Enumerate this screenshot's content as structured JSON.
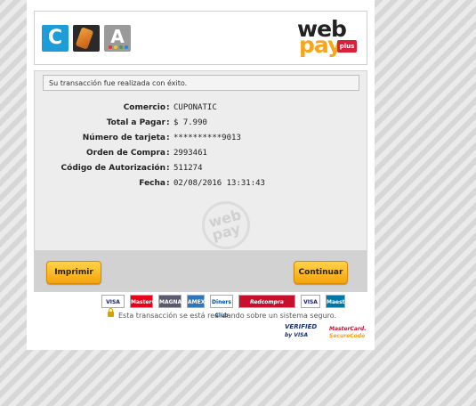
{
  "header": {
    "logos": [
      {
        "name": "cuponatic-logo",
        "text": "C",
        "color": "#1e9cd8"
      },
      {
        "name": "tag-logo",
        "text": "",
        "color": "#2a2a2a"
      },
      {
        "name": "a-logo",
        "text": "A",
        "color": "#9a9a9a"
      }
    ],
    "webpay": {
      "web": "web",
      "pay": "pay",
      "plus": "plus"
    }
  },
  "status_message": "Su transacción fue realizada con éxito.",
  "details": [
    {
      "label": "Comercio",
      "value": "CUPONATIC"
    },
    {
      "label": "Total a Pagar",
      "value": "$ 7.990"
    },
    {
      "label": "Número de tarjeta",
      "value": "**********9013"
    },
    {
      "label": "Orden de Compra",
      "value": "2993461"
    },
    {
      "label": "Código de Autorización",
      "value": "511274"
    },
    {
      "label": "Fecha",
      "value": "02/08/2016 13:31:43"
    }
  ],
  "watermark": "web pay",
  "buttons": {
    "print": "Imprimir",
    "continue": "Continuar"
  },
  "card_logos": [
    "VISA",
    "MasterCard",
    "MAGNA",
    "AMEX",
    "Diners Club",
    "Redcompra",
    "VISA",
    "Maestro"
  ],
  "secure_text": "Esta transacción se está realizando sobre un sistema seguro.",
  "verified_by_visa": {
    "line1": "VERIFIED",
    "line2": "by VISA"
  },
  "mastercard_securecode": {
    "line1": "MasterCard.",
    "line2": "SecureCode"
  },
  "colors": {
    "accent_button": "#f5a40c",
    "brand_blue": "#1e9cd8",
    "webpay_orange": "#f7a51a",
    "webpay_red": "#d8203a"
  }
}
